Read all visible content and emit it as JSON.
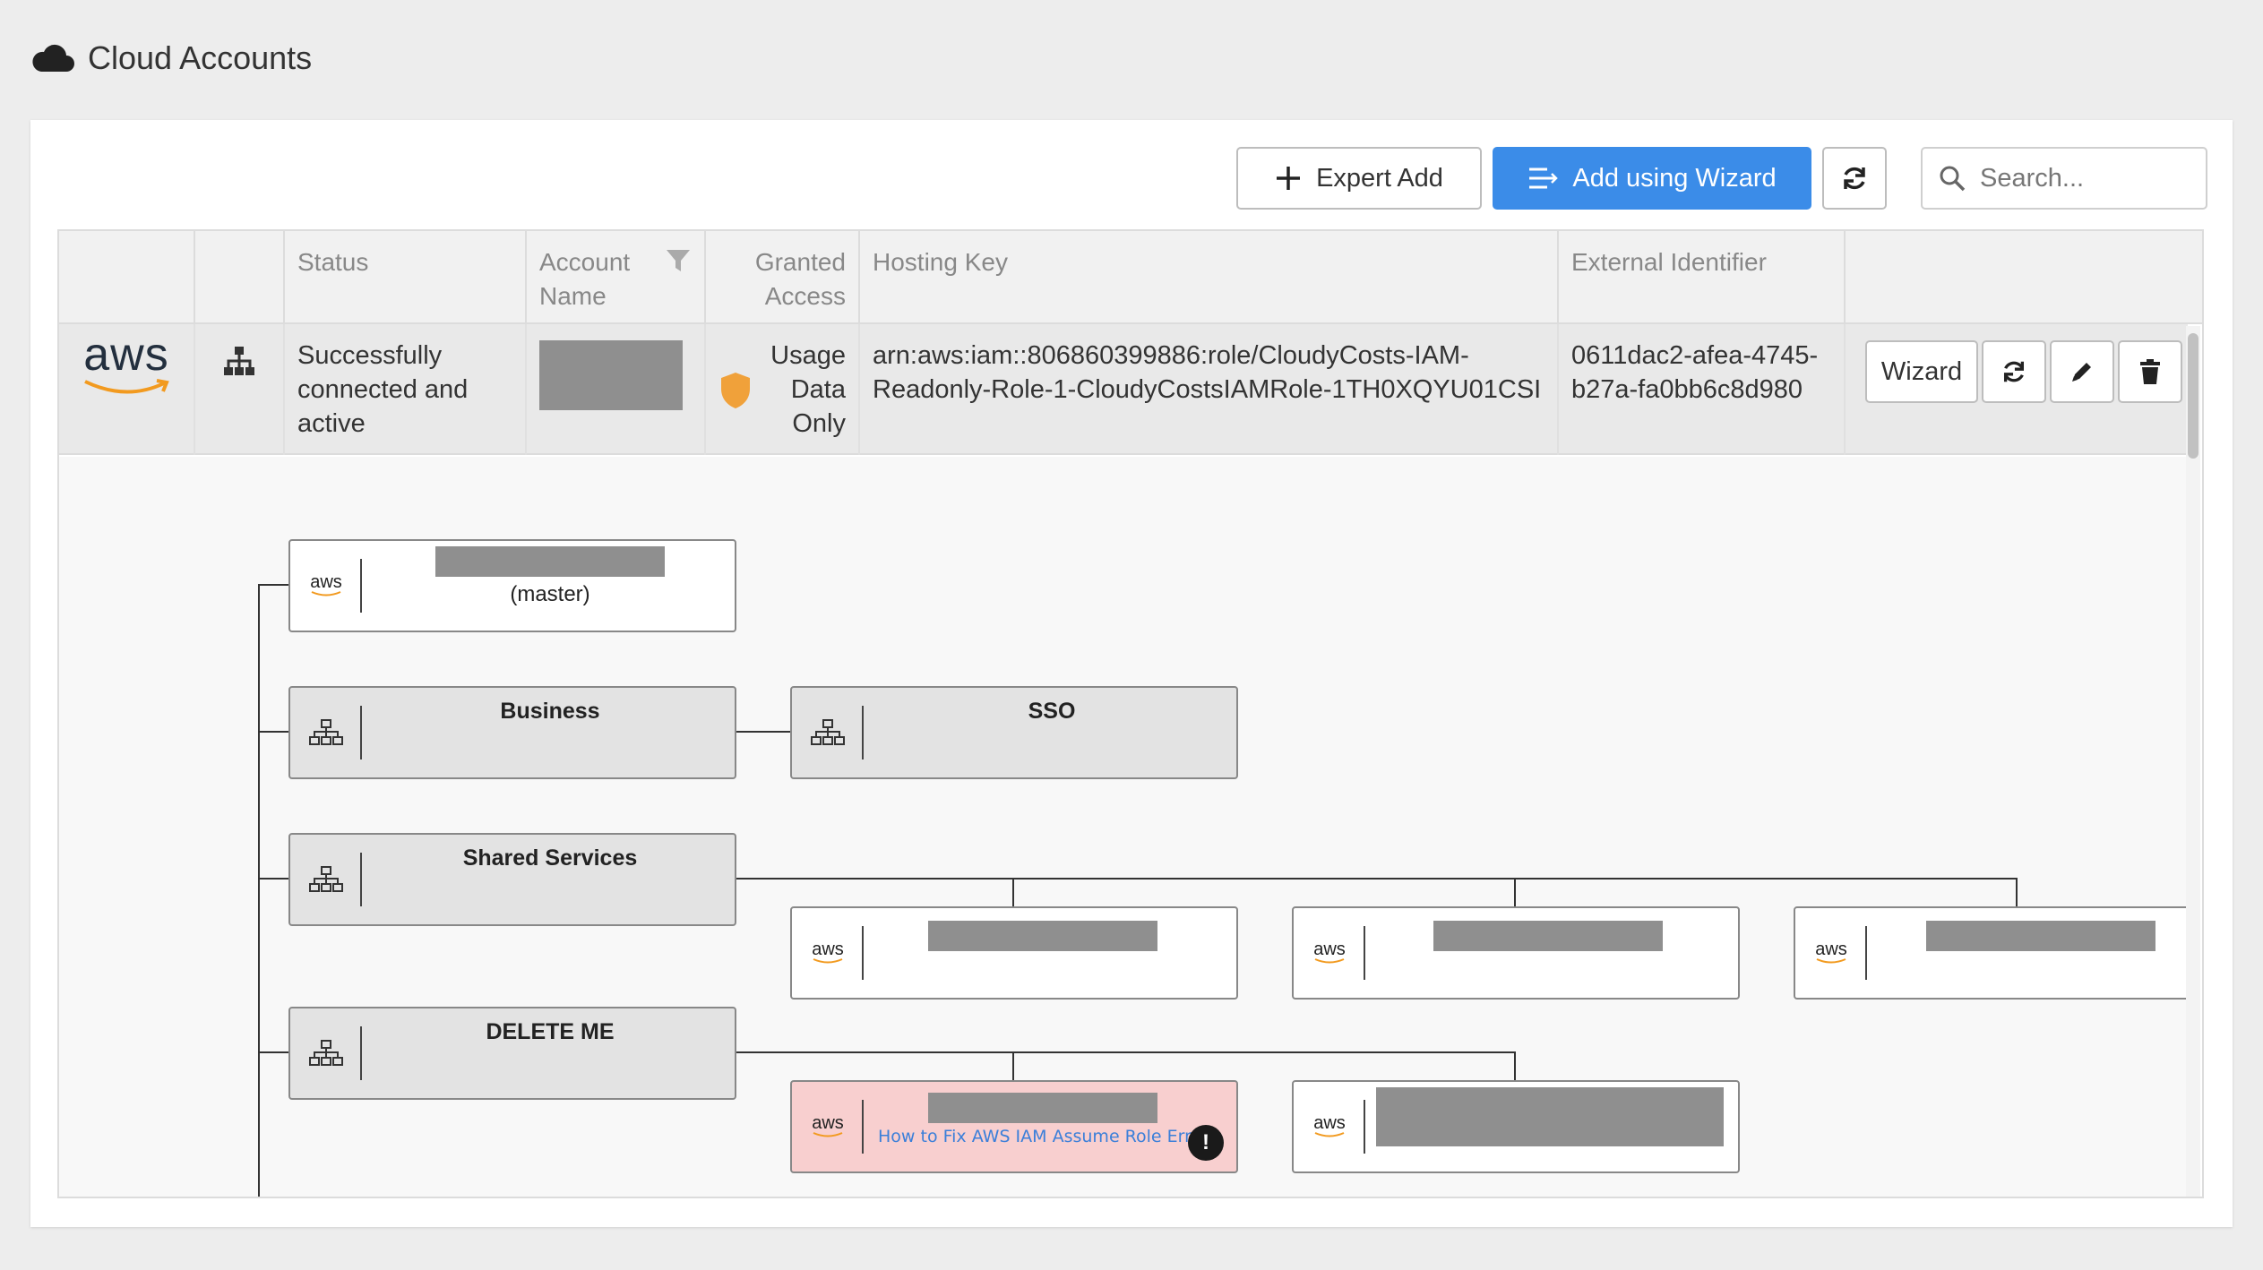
{
  "page": {
    "title": "Cloud Accounts",
    "title_icon": "cloud-icon"
  },
  "toolbar": {
    "expert_add_label": "Expert Add",
    "wizard_label": "Add using Wizard",
    "search_placeholder": "Search..."
  },
  "table": {
    "headers": {
      "status": "Status",
      "account_name_1": "Account",
      "account_name_2": "Name",
      "granted_1": "Granted",
      "granted_2": "Access",
      "hosting_key": "Hosting Key",
      "external_id": "External Identifier"
    },
    "row": {
      "provider_logo": "aws",
      "status": "Successfully connected and active",
      "granted_1": "Usage",
      "granted_2": "Data",
      "granted_3": "Only",
      "hosting_key_1": "arn:aws:iam::806860399886:role/CloudyCosts-IAM-",
      "hosting_key_2": "Readonly-Role-1-CloudyCostsIAMRole-1TH0XQYU01CSI",
      "external_id_1": "0611dac2-afea-4745-",
      "external_id_2": "b27a-fa0bb6c8d980",
      "wizard_label": "Wizard"
    }
  },
  "tree": {
    "master_sub": "(master)",
    "business": "Business",
    "sso": "SSO",
    "shared_services": "Shared Services",
    "delete_me": "DELETE ME",
    "aws_small": "aws",
    "error_link": "How to Fix AWS IAM Assume Role Errors",
    "error_badge": "!"
  },
  "colors": {
    "primary": "#3b8ce8",
    "shield": "#f0a13a",
    "aws_orange": "#f29a1f",
    "error_bg": "#f8cfcf"
  }
}
